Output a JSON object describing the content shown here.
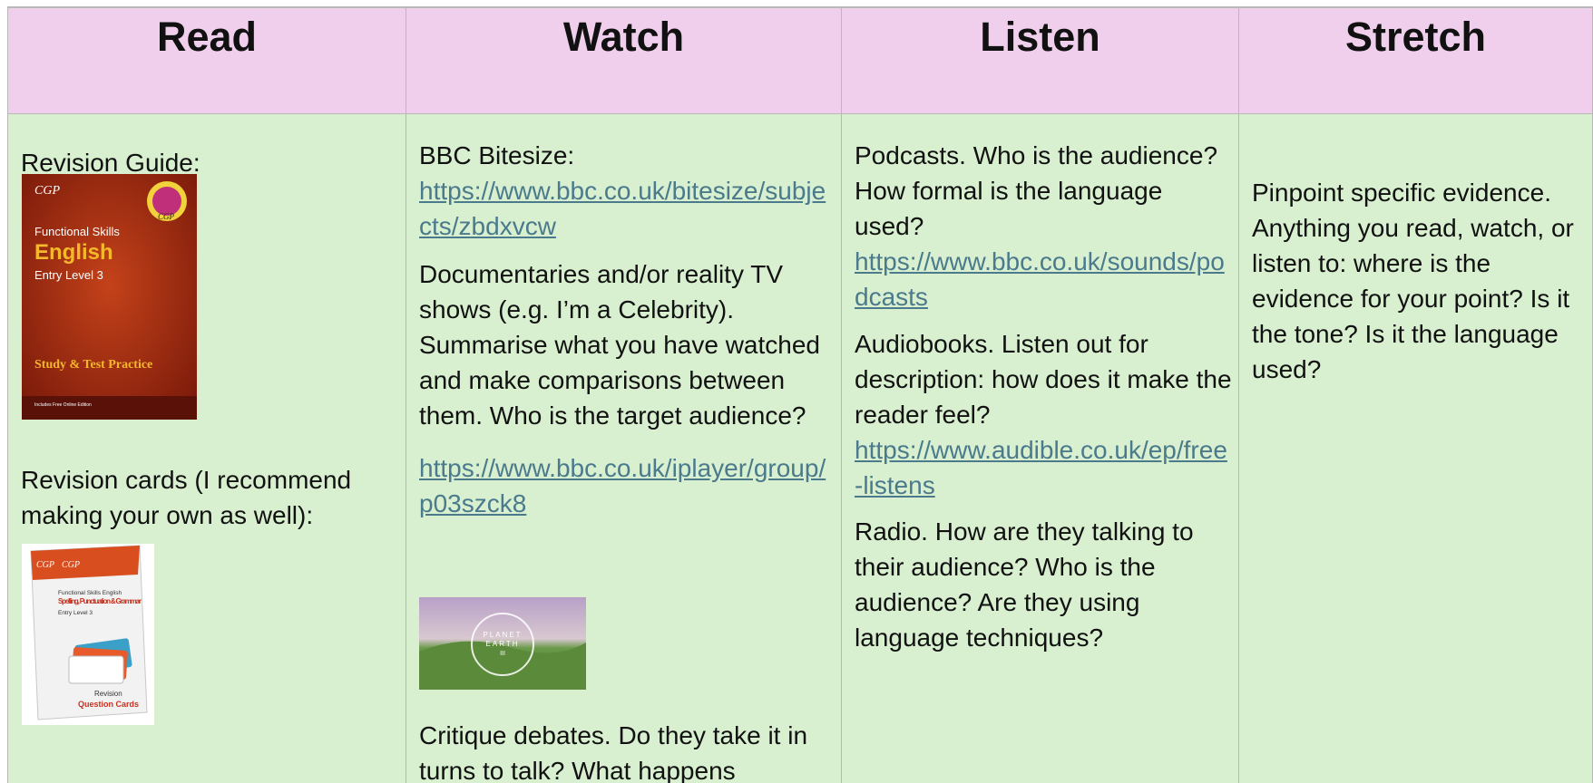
{
  "headers": {
    "read": "Read",
    "watch": "Watch",
    "listen": "Listen",
    "stretch": "Stretch"
  },
  "read": {
    "guide_label": "Revision Guide:",
    "cards_label": "Revision cards (I recommend making your own as well):",
    "book": {
      "brand": "CGP",
      "line1": "Functional Skills",
      "subject": "English",
      "level": "Entry Level 3",
      "practice": "Study & Test Practice",
      "small": "Includes Free Online Edition"
    },
    "cards": {
      "brand": "CGP",
      "line1": "Functional Skills English",
      "title": "Spelling, Punctuation & Grammar",
      "level": "Entry Level 3",
      "rev": "Revision",
      "qc": "Question Cards"
    }
  },
  "watch": {
    "bitesize_label": "BBC Bitesize:",
    "bitesize_url": "https://www.bbc.co.uk/bitesize/subjects/zbdxvcw",
    "documentaries_text": "Documentaries and/or reality TV shows (e.g. I’m a Celebrity). Summarise what you have watched and make comparisons between them. Who is the target audience?",
    "iplayer_url": "https://www.bbc.co.uk/iplayer/group/p03szck8",
    "planet_earth": {
      "line1": "PLANET",
      "line2": "EARTH",
      "line3": "III"
    },
    "debates_text": "Critique debates. Do they take it in turns to talk? What happens"
  },
  "listen": {
    "podcasts_text": "Podcasts. Who is the audience? How formal is the language used?",
    "podcasts_url": "https://www.bbc.co.uk/sounds/podcasts",
    "audiobooks_text": "Audiobooks. Listen out for description: how does it make the reader feel?",
    "audible_url": "https://www.audible.co.uk/ep/free-listens",
    "radio_text": "Radio. How are they talking to their audience? Who is the audience? Are they using language techniques?"
  },
  "stretch": {
    "text": "Pinpoint specific evidence. Anything you read, watch, or listen to: where is the evidence for your point? Is it the tone? Is it the language used?"
  },
  "colors": {
    "header_bg": "#f0cfec",
    "cell_bg": "#d8f0d0",
    "link": "#4a7a8c"
  }
}
